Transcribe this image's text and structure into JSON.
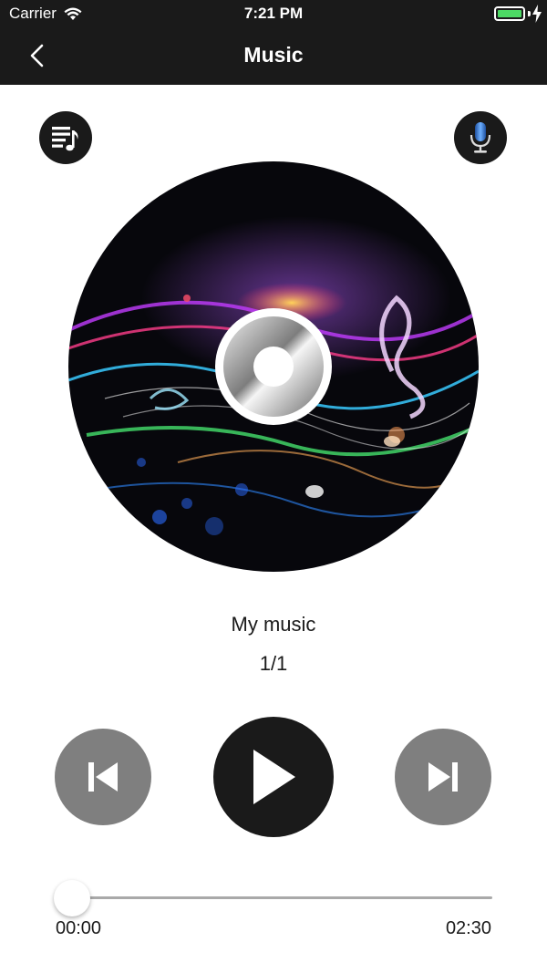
{
  "status_bar": {
    "carrier": "Carrier",
    "time": "7:21 PM",
    "battery_color": "#4cd964"
  },
  "nav": {
    "title": "Music",
    "back_icon": "chevron-left-icon"
  },
  "toolbar": {
    "playlist_icon": "playlist-icon",
    "microphone_icon": "microphone-icon"
  },
  "player": {
    "track_title": "My music",
    "track_index": "1/1",
    "progress": 0,
    "elapsed": "00:00",
    "duration": "02:30",
    "controls": {
      "previous_icon": "skip-previous-icon",
      "play_icon": "play-icon",
      "next_icon": "skip-next-icon"
    }
  },
  "colors": {
    "bar": "#1a1a1a",
    "side_buttons": "#7f7f7f",
    "mic_accent": "#2f78d4"
  }
}
